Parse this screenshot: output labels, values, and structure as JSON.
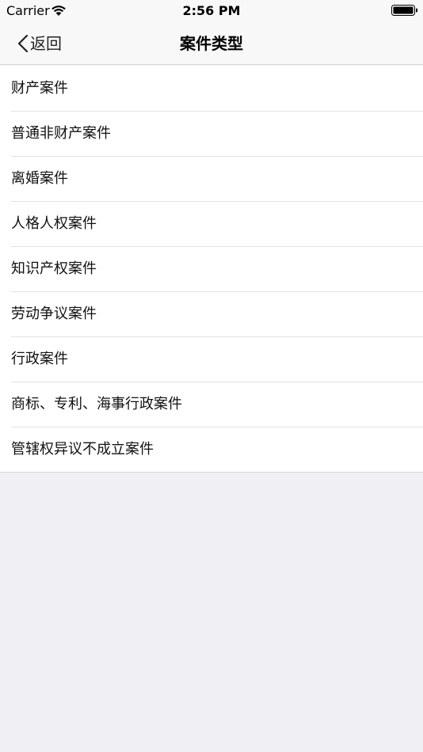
{
  "status_bar": {
    "carrier": "Carrier",
    "time": "2:56 PM"
  },
  "nav": {
    "back_label": "返回",
    "title": "案件类型"
  },
  "case_types": [
    "财产案件",
    "普通非财产案件",
    "离婚案件",
    "人格人权案件",
    "知识产权案件",
    "劳动争议案件",
    "行政案件",
    "商标、专利、海事行政案件",
    "管辖权异议不成立案件"
  ],
  "colors": {
    "page_background": "#efeff4",
    "nav_background": "#f8f8f8",
    "list_background": "#ffffff",
    "separator": "#e2e2e6"
  }
}
